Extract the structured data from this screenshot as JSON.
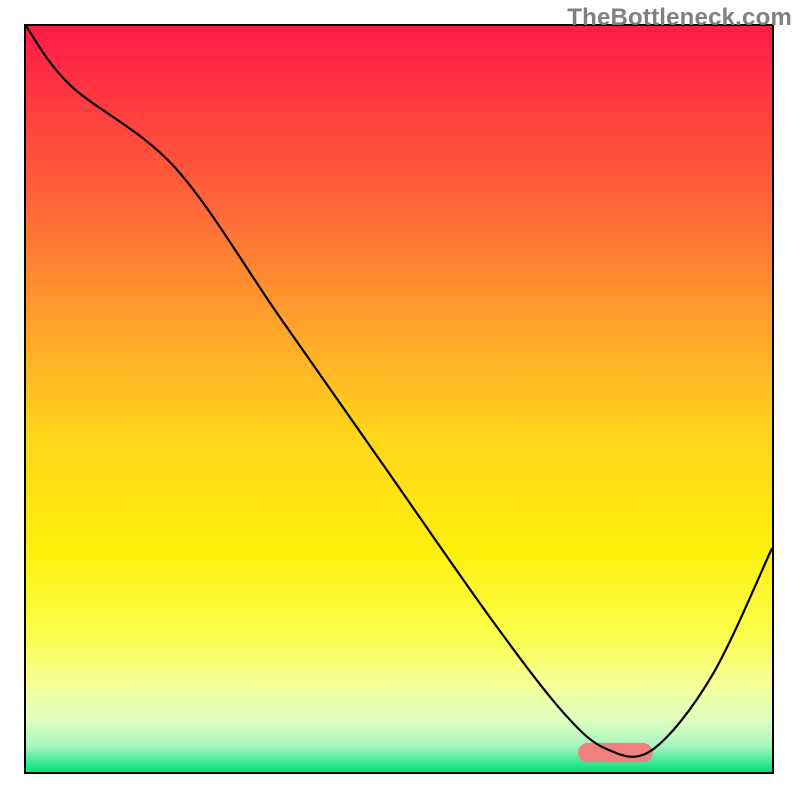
{
  "watermark": "TheBottleneck.com",
  "chart_data": {
    "type": "line",
    "title": "",
    "xlabel": "",
    "ylabel": "",
    "xlim": [
      0,
      100
    ],
    "ylim": [
      0,
      100
    ],
    "grid": false,
    "legend": false,
    "background_gradient_stops": [
      {
        "offset": 0.0,
        "color": "#ff1b47"
      },
      {
        "offset": 0.1,
        "color": "#ff3940"
      },
      {
        "offset": 0.25,
        "color": "#ff6a37"
      },
      {
        "offset": 0.4,
        "color": "#ffa22c"
      },
      {
        "offset": 0.55,
        "color": "#ffd61b"
      },
      {
        "offset": 0.7,
        "color": "#ffef0a"
      },
      {
        "offset": 0.82,
        "color": "#fbff4f"
      },
      {
        "offset": 0.88,
        "color": "#f6ff94"
      },
      {
        "offset": 0.93,
        "color": "#dfffbf"
      },
      {
        "offset": 0.965,
        "color": "#a7f5c0"
      },
      {
        "offset": 1.0,
        "color": "#00e27a"
      }
    ],
    "series": [
      {
        "name": "bottleneck-curve",
        "color": "#000000",
        "x": [
          0,
          6,
          20,
          34,
          48,
          62,
          72,
          78,
          84,
          92,
          100
        ],
        "y": [
          100,
          92,
          81,
          61,
          41,
          21,
          8,
          3,
          3,
          13,
          30
        ]
      }
    ],
    "marker": {
      "name": "optimal-range",
      "color": "#f08080",
      "x_start": 74,
      "x_end": 84,
      "y": 2.6,
      "thickness": 2.6
    }
  }
}
